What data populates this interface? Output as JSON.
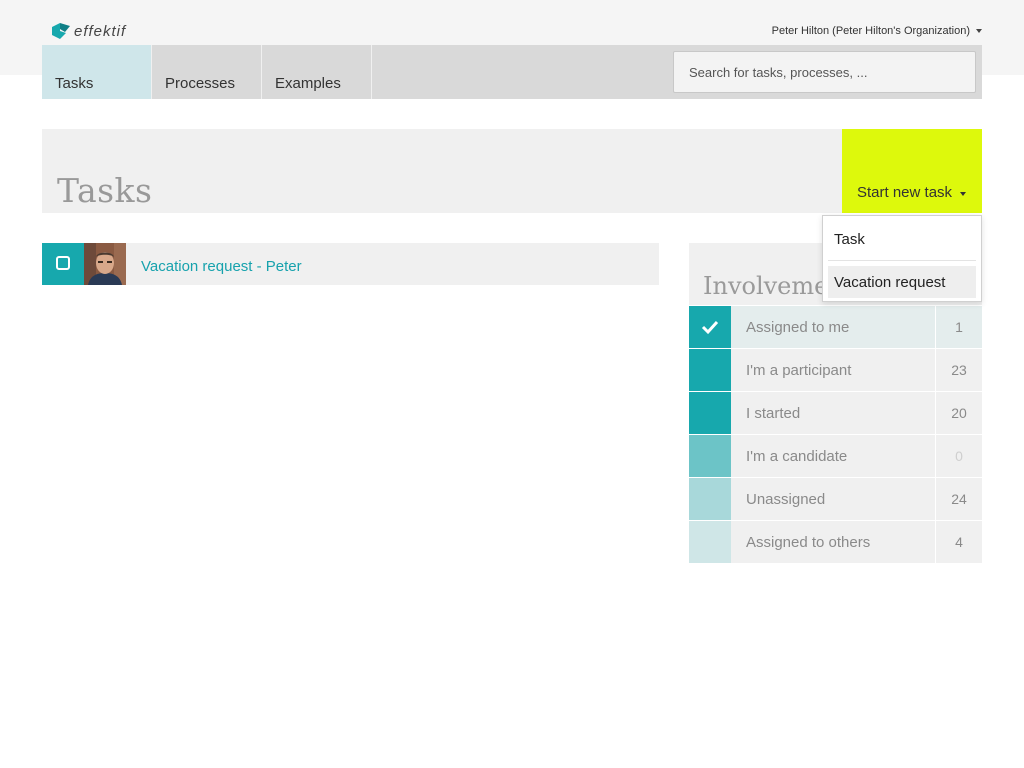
{
  "app": {
    "logo_text": "effektif"
  },
  "user": {
    "label": "Peter Hilton (Peter Hilton's Organization)"
  },
  "nav": {
    "tabs": [
      {
        "label": "Tasks",
        "active": true
      },
      {
        "label": "Processes",
        "active": false
      },
      {
        "label": "Examples",
        "active": false
      }
    ],
    "search_placeholder": "Search for tasks, processes, ..."
  },
  "page": {
    "title": "Tasks"
  },
  "start_button": {
    "label": "Start new task"
  },
  "dropdown": {
    "items": [
      {
        "label": "Task"
      },
      {
        "label": "Vacation request"
      }
    ]
  },
  "tasks": [
    {
      "title": "Vacation request - Peter",
      "done": false
    }
  ],
  "involvement": {
    "title": "Involvement",
    "filters": [
      {
        "label": "Assigned to me",
        "count": "1",
        "selected": true,
        "color": "#17a8ad"
      },
      {
        "label": "I'm a participant",
        "count": "23",
        "selected": false,
        "color": "#17a8ad"
      },
      {
        "label": "I started",
        "count": "20",
        "selected": false,
        "color": "#17a8ad"
      },
      {
        "label": "I'm a candidate",
        "count": "0",
        "selected": false,
        "color": "#6cc4c7"
      },
      {
        "label": "Unassigned",
        "count": "24",
        "selected": false,
        "color": "#a8d8da"
      },
      {
        "label": "Assigned to others",
        "count": "4",
        "selected": false,
        "color": "#cfe6e7"
      }
    ]
  },
  "colors": {
    "accent": "#17a8ad",
    "start_button": "#ddf90c",
    "link": "#17a2ad"
  }
}
